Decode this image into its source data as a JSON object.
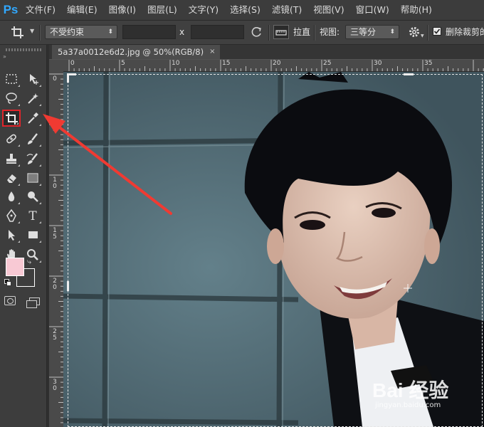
{
  "app": {
    "logo": "Ps"
  },
  "menu": [
    "文件(F)",
    "编辑(E)",
    "图像(I)",
    "图层(L)",
    "文字(Y)",
    "选择(S)",
    "滤镜(T)",
    "视图(V)",
    "窗口(W)",
    "帮助(H)"
  ],
  "options": {
    "ratio_select": "不受约束",
    "x_separator": "x",
    "straighten_label": "拉直",
    "view_label": "视图:",
    "view_select": "三等分",
    "delete_cropped_label": "删除裁剪的",
    "delete_cropped_checked": true
  },
  "document": {
    "tab_title": "5a37a0012e6d2.jpg @ 50%(RGB/8)",
    "close_glyph": "×"
  },
  "rulers": {
    "top": [
      "0",
      "5",
      "10",
      "15",
      "20",
      "25",
      "30",
      "35"
    ],
    "left": [
      "0",
      "5",
      "1\n0",
      "1\n5",
      "2\n0",
      "2\n5",
      "3\n0"
    ]
  },
  "watermark": {
    "brand": "Bai 经验",
    "url": "jingyan.baidu.com"
  },
  "colors": {
    "foreground": "#f8c9d4",
    "background": "#3d3d3d",
    "highlight": "#e0252b",
    "arrow": "#f03a32"
  },
  "tools": [
    "marquee-icon",
    "move-icon",
    "lasso-icon",
    "magic-wand-icon",
    "crop-icon",
    "eyedropper-icon",
    "healing-brush-icon",
    "brush-icon",
    "clone-stamp-icon",
    "history-brush-icon",
    "eraser-icon",
    "gradient-icon",
    "blur-icon",
    "dodge-icon",
    "pen-icon",
    "type-icon",
    "path-select-icon",
    "rectangle-icon",
    "hand-icon",
    "zoom-icon"
  ]
}
